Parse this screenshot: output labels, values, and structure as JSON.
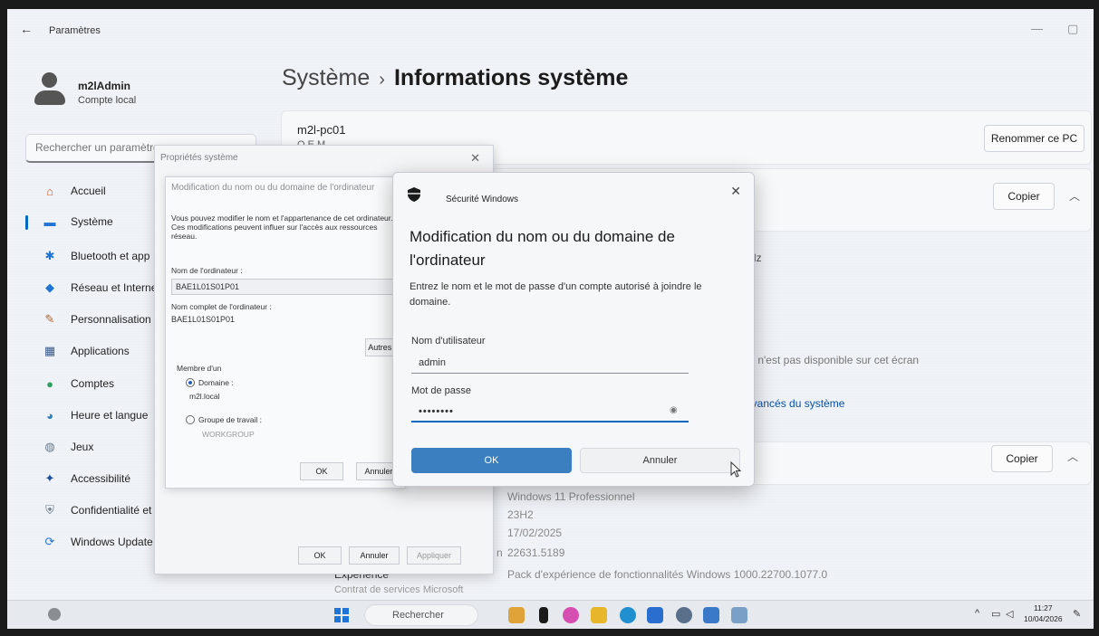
{
  "window": {
    "title": "Paramètres",
    "back_icon": "←",
    "minimize_icon": "—",
    "restore_icon": "▢"
  },
  "profile": {
    "name": "m2lAdmin",
    "subtitle": "Compte local"
  },
  "search": {
    "placeholder": "Rechercher un paramètre"
  },
  "sidebar": {
    "items": [
      {
        "label": "Accueil",
        "icon": "home-icon",
        "glyph": "⌂",
        "color": "#d05a2a"
      },
      {
        "label": "Système",
        "icon": "system-icon",
        "glyph": "▬",
        "color": "#1f74d6"
      },
      {
        "label": "Bluetooth et app",
        "icon": "bluetooth-icon",
        "glyph": "✱",
        "color": "#1f74d6"
      },
      {
        "label": "Réseau et Interne",
        "icon": "network-icon",
        "glyph": "◆",
        "color": "#1f74d6"
      },
      {
        "label": "Personnalisation",
        "icon": "brush-icon",
        "glyph": "✎",
        "color": "#b0602a"
      },
      {
        "label": "Applications",
        "icon": "apps-icon",
        "glyph": "▦",
        "color": "#3b5b8a"
      },
      {
        "label": "Comptes",
        "icon": "accounts-icon",
        "glyph": "●",
        "color": "#2f9e5e"
      },
      {
        "label": "Heure et langue",
        "icon": "time-language-icon",
        "glyph": "◕",
        "color": "#2a7fc0"
      },
      {
        "label": "Jeux",
        "icon": "games-icon",
        "glyph": "◍",
        "color": "#6a7a8a"
      },
      {
        "label": "Accessibilité",
        "icon": "accessibility-icon",
        "glyph": "✦",
        "color": "#1a4f9a"
      },
      {
        "label": "Confidentialité et",
        "icon": "privacy-shield-icon",
        "glyph": "⛨",
        "color": "#6a7a8a"
      },
      {
        "label": "Windows Update",
        "icon": "windows-update-icon",
        "glyph": "⟳",
        "color": "#1f74d6"
      }
    ]
  },
  "main": {
    "breadcrumb_parent": "Système",
    "breadcrumb_sep": "›",
    "breadcrumb_current": "Informations système",
    "pc_name": "m2l-pc01",
    "pc_model": "O E M",
    "rename_button": "Renommer ce PC",
    "copy_button": "Copier",
    "copy_button_2": "Copier",
    "hz_text": "Hz",
    "not_available_text": "et n'est pas disponible sur cet écran",
    "advanced_link": "avancés du système",
    "spec_values": [
      "Windows 11 Professionnel",
      "23H2",
      "17/02/2025",
      "22631.5189",
      "Pack d'expérience de fonctionnalités Windows 1000.22700.1077.0"
    ],
    "experience_label": "Expérience",
    "build_label_fragment": "n",
    "cut_label": "Contrat de services Microsoft"
  },
  "sysprops": {
    "title": "Propriétés système",
    "close_icon": "✕",
    "ok": "OK",
    "cancel": "Annuler",
    "apply": "Appliquer"
  },
  "modif_dialog": {
    "title": "Modification du nom ou du domaine de l'ordinateur",
    "description": "Vous pouvez modifier le nom et l'appartenance de cet ordinateur. Ces modifications peuvent influer sur l'accès aux ressources réseau.",
    "computer_name_label": "Nom de l'ordinateur :",
    "computer_name_value": "BAE1L01S01P01",
    "full_name_label": "Nom complet de l'ordinateur :",
    "full_name_value": "BAE1L01S01P01",
    "other_button": "Autres...",
    "member_of_label": "Membre d'un",
    "domain_label": "Domaine :",
    "domain_value": "m2l.local",
    "workgroup_label": "Groupe de travail :",
    "workgroup_value": "WORKGROUP",
    "ok": "OK",
    "cancel": "Annuler"
  },
  "security_dialog": {
    "app_name": "Sécurité Windows",
    "close_icon": "✕",
    "heading": "Modification du nom ou du domaine de l'ordinateur",
    "description": "Entrez le nom et le mot de passe d'un compte autorisé à joindre le domaine.",
    "username_label": "Nom d'utilisateur",
    "username_value": "admin",
    "password_label": "Mot de passe",
    "password_value": "••••••••",
    "eye_icon": "◉",
    "ok": "OK",
    "cancel": "Annuler"
  },
  "taskbar": {
    "search_label": "Rechercher",
    "tray_chevron": "^",
    "time": "11:27",
    "date": "10/04/2026",
    "apps": [
      {
        "icon": "cat-app-icon",
        "color": "#e0a33a"
      },
      {
        "icon": "l-app-icon",
        "color": "#1b1b1b"
      },
      {
        "icon": "copilot-icon",
        "color": "#d64fb0"
      },
      {
        "icon": "file-explorer-icon",
        "color": "#e8b62a"
      },
      {
        "icon": "edge-icon",
        "color": "#1f8fcf"
      },
      {
        "icon": "store-icon",
        "color": "#2a6fd0"
      },
      {
        "icon": "settings-gear-icon",
        "color": "#5a6f8a"
      },
      {
        "icon": "remote-desktop-icon",
        "color": "#3a78c8"
      },
      {
        "icon": "notepad-icon",
        "color": "#7aa0c8"
      }
    ]
  }
}
